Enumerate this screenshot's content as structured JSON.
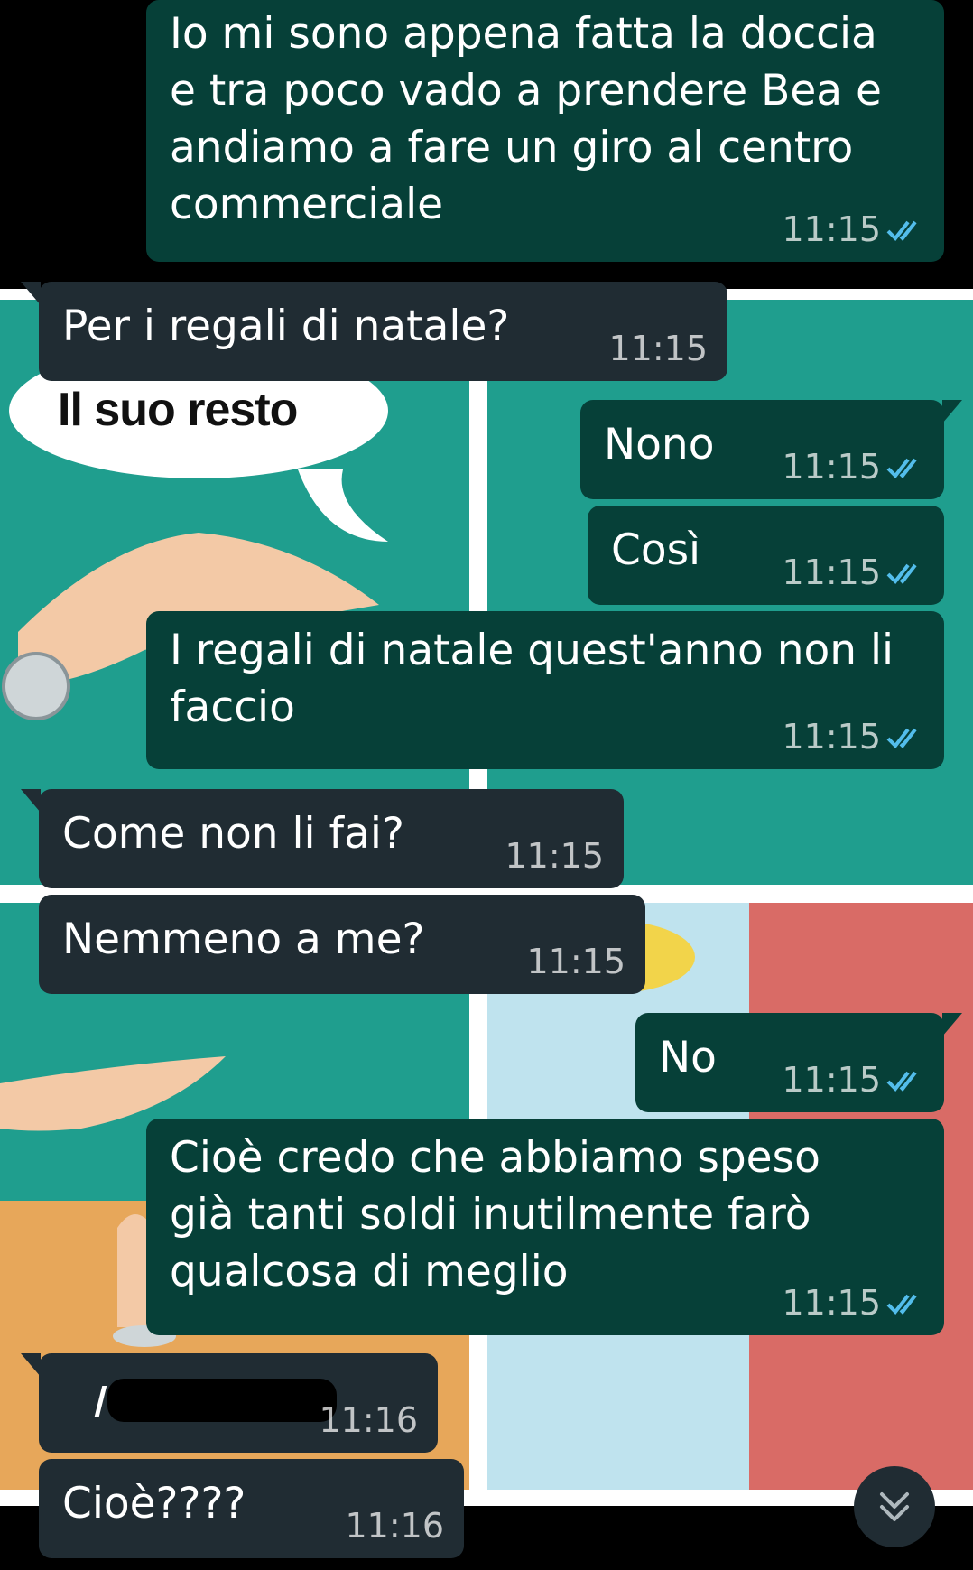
{
  "colors": {
    "incoming_bubble": "#202c33",
    "outgoing_bubble": "#064038",
    "read_tick": "#53bdeb",
    "comic_teal": "#1f9e8e",
    "comic_orange": "#e7a75a",
    "comic_red": "#d96b66"
  },
  "background_comic": {
    "speech_bubble_text": "Il suo resto"
  },
  "messages": [
    {
      "id": "m1",
      "direction": "outgoing",
      "text": "Io mi sono appena fatta la doccia\ne tra poco vado a prendere Bea e\nandiamo a fare un giro al centro\ncommerciale",
      "time": "11:15",
      "status_icon": "double-check-read-icon"
    },
    {
      "id": "m2",
      "direction": "incoming",
      "text": "Per i regali di natale?",
      "time": "11:15"
    },
    {
      "id": "m3",
      "direction": "outgoing",
      "text": "Nono",
      "time": "11:15",
      "status_icon": "double-check-read-icon"
    },
    {
      "id": "m4",
      "direction": "outgoing",
      "text": "Così",
      "time": "11:15",
      "status_icon": "double-check-read-icon"
    },
    {
      "id": "m5",
      "direction": "outgoing",
      "text": "I regali di natale quest'anno non li\nfaccio",
      "time": "11:15",
      "status_icon": "double-check-read-icon"
    },
    {
      "id": "m6",
      "direction": "incoming",
      "text": "Come non li fai?",
      "time": "11:15"
    },
    {
      "id": "m7",
      "direction": "incoming",
      "text": "Nemmeno a me?",
      "time": "11:15"
    },
    {
      "id": "m8",
      "direction": "outgoing",
      "text": "No",
      "time": "11:15",
      "status_icon": "double-check-read-icon"
    },
    {
      "id": "m9",
      "direction": "outgoing",
      "text": "Cioè credo che abbiamo speso\ngià tanti soldi inutilmente farò\nqualcosa di meglio",
      "time": "11:15",
      "status_icon": "double-check-read-icon"
    },
    {
      "id": "m10",
      "direction": "incoming",
      "text": "",
      "time": "11:16",
      "redacted": true
    },
    {
      "id": "m11",
      "direction": "incoming",
      "text": "Cioè????",
      "time": "11:16"
    }
  ],
  "scroll_button": {
    "icon": "double-chevron-down-icon"
  }
}
